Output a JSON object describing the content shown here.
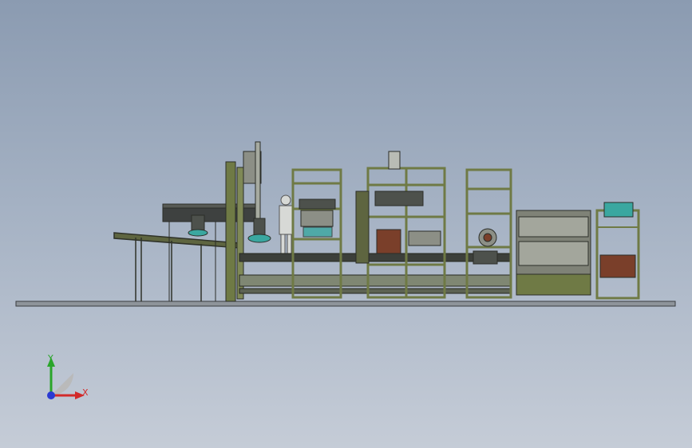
{
  "viewport": {
    "background_top": "#8b9bb1",
    "background_bottom": "#c5ccd7"
  },
  "model": {
    "frame_color": "#6f7a45",
    "panel_color": "#8c8f86",
    "conveyor_color": "#3c3f3a",
    "accent_teal": "#3aa7a0",
    "accent_brown": "#7a3f2a"
  },
  "triad": {
    "x_label": "X",
    "y_label": "Y",
    "x_color": "#d22a2a",
    "y_color": "#2aa52a",
    "z_color": "#2a3ad2"
  }
}
